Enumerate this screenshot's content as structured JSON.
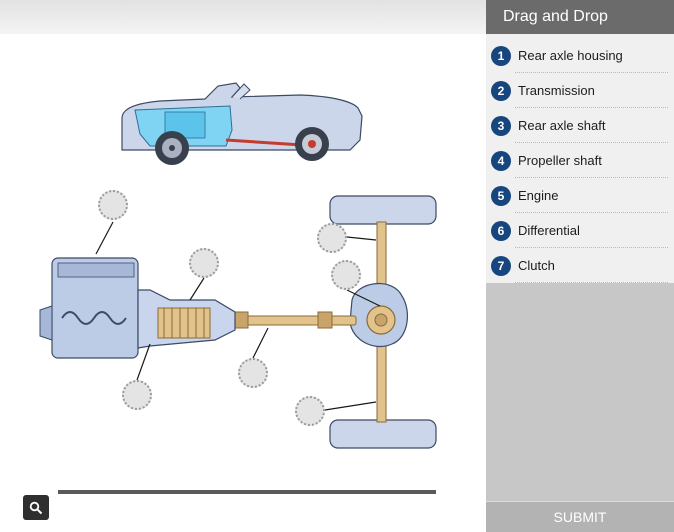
{
  "panel": {
    "title": "Drag and Drop",
    "items": [
      {
        "num": "1",
        "label": "Rear axle housing"
      },
      {
        "num": "2",
        "label": "Transmission"
      },
      {
        "num": "3",
        "label": "Rear axle shaft"
      },
      {
        "num": "4",
        "label": "Propeller shaft"
      },
      {
        "num": "5",
        "label": "Engine"
      },
      {
        "num": "6",
        "label": "Differential"
      },
      {
        "num": "7",
        "label": "Clutch"
      }
    ],
    "submit_label": "SUBMIT"
  },
  "drop_zones": [
    "drop-zone-1",
    "drop-zone-2",
    "drop-zone-3",
    "drop-zone-4",
    "drop-zone-5",
    "drop-zone-6",
    "drop-zone-7"
  ],
  "icons": {
    "zoom": "magnifier-icon"
  },
  "colors": {
    "number_badge": "#17457d",
    "panel_header": "#6b6b6b",
    "drivetrain_highlight": "#7fd3f3",
    "shaft_tan": "#e3c38c"
  }
}
